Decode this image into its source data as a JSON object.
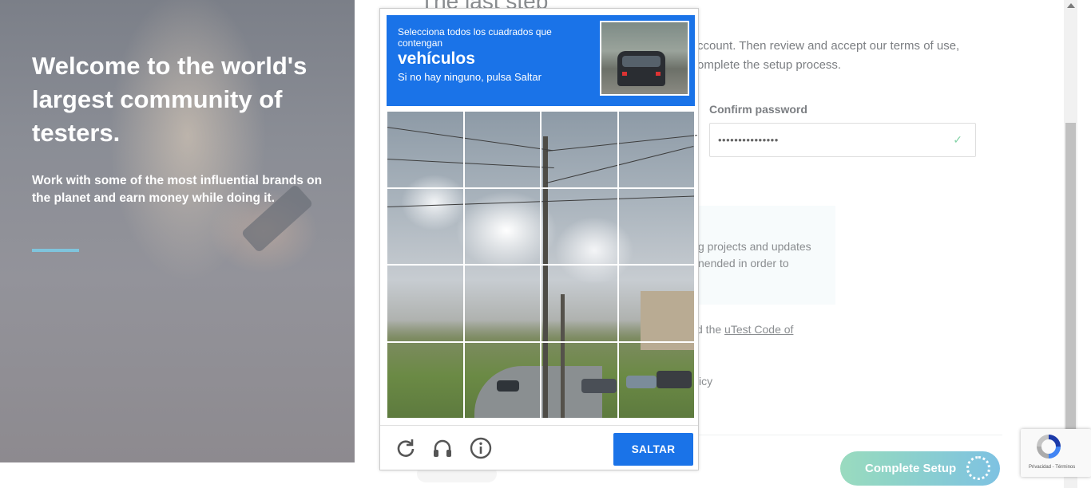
{
  "hero": {
    "headline": "Welcome to the world's largest community of testers.",
    "subtext": "Work with some of the most influential brands on the planet and earn money while doing it."
  },
  "form": {
    "step_title": "The last step",
    "intro_line1": "ccount. Then review and accept our terms of use,",
    "intro_line2": "omplete the setup process.",
    "confirm_password_label": "Confirm password",
    "confirm_password_value": "•••••••••••••••",
    "note_line1": "g projects and updates",
    "note_line2": "nended in order to",
    "code_prefix": "d the ",
    "code_link": "uTest Code of",
    "policy_fragment": "icy",
    "complete_button": "Complete Setup"
  },
  "captcha": {
    "instruction": "Selecciona todos los cuadrados que contengan",
    "target": "vehículos",
    "hint": "Si no hay ninguno, pulsa Saltar",
    "skip_button": "SALTAR",
    "icons": [
      "reload-icon",
      "audio-icon",
      "info-icon"
    ]
  },
  "recaptcha_badge": {
    "terms": "Privacidad - Términos"
  },
  "colors": {
    "captcha_blue": "#1a73e8",
    "hero_accent": "#7fc4dc",
    "success_check": "#84d3a7"
  }
}
